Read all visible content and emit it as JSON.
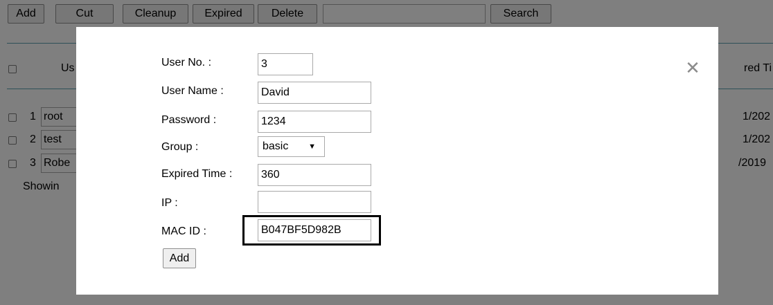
{
  "toolbar": {
    "add": "Add",
    "cut": "Cut",
    "cleanup": "Cleanup",
    "expired": "Expired",
    "delete": "Delete",
    "search_value": "",
    "search": "Search"
  },
  "table": {
    "header_left": "Us",
    "header_right": "red Ti",
    "rows": [
      {
        "no": "1",
        "name": "root",
        "expired": "1/202"
      },
      {
        "no": "2",
        "name": "test",
        "expired": "1/202"
      },
      {
        "no": "3",
        "name": "Robe",
        "expired": "/2019"
      }
    ],
    "footer": "Showin"
  },
  "modal": {
    "close_glyph": "✕",
    "fields": {
      "user_no": {
        "label": "User No. :",
        "value": "3"
      },
      "user_name": {
        "label": "User Name :",
        "value": "David"
      },
      "password": {
        "label": "Password :",
        "value": "1234"
      },
      "group": {
        "label": "Group :",
        "value": "basic"
      },
      "expired_time": {
        "label": "Expired Time :",
        "value": "360"
      },
      "ip": {
        "label": "IP :",
        "value": ""
      },
      "mac_id": {
        "label": "MAC ID :",
        "value": "B047BF5D982B"
      }
    },
    "add_button": "Add"
  },
  "colors": {
    "overlay": "rgba(0,0,0,0.5)",
    "rule": "#5aa0ae",
    "highlight_border": "#000000"
  }
}
